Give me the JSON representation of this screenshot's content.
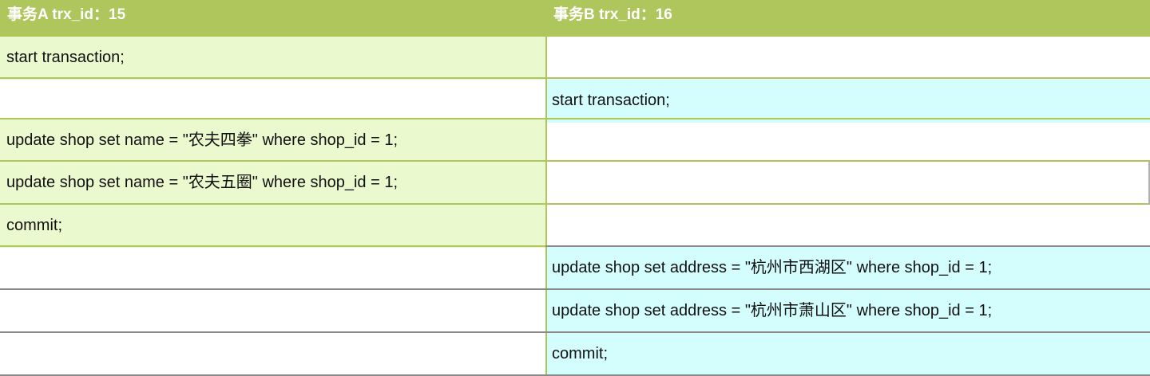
{
  "header": {
    "col_a": "事务A trx_id：15",
    "col_b": "事务B trx_id：16"
  },
  "rows": [
    {
      "a": "start transaction;",
      "b": ""
    },
    {
      "a": "",
      "b": "start transaction;"
    },
    {
      "a": "update shop set name = \"农夫四拳\" where shop_id = 1;",
      "b": ""
    },
    {
      "a": "update shop set name = \"农夫五圈\" where shop_id = 1;",
      "b": ""
    },
    {
      "a": "commit;",
      "b": ""
    },
    {
      "a": "",
      "b": "update shop set address = \"杭州市西湖区\" where shop_id = 1;"
    },
    {
      "a": "",
      "b": "update shop set address = \"杭州市萧山区\" where shop_id = 1;"
    },
    {
      "a": "",
      "b": "commit;"
    }
  ],
  "colors": {
    "header_bg": "#aec65b",
    "col_a_fill": "#ebf9cf",
    "col_b_fill": "#d4fefe"
  }
}
